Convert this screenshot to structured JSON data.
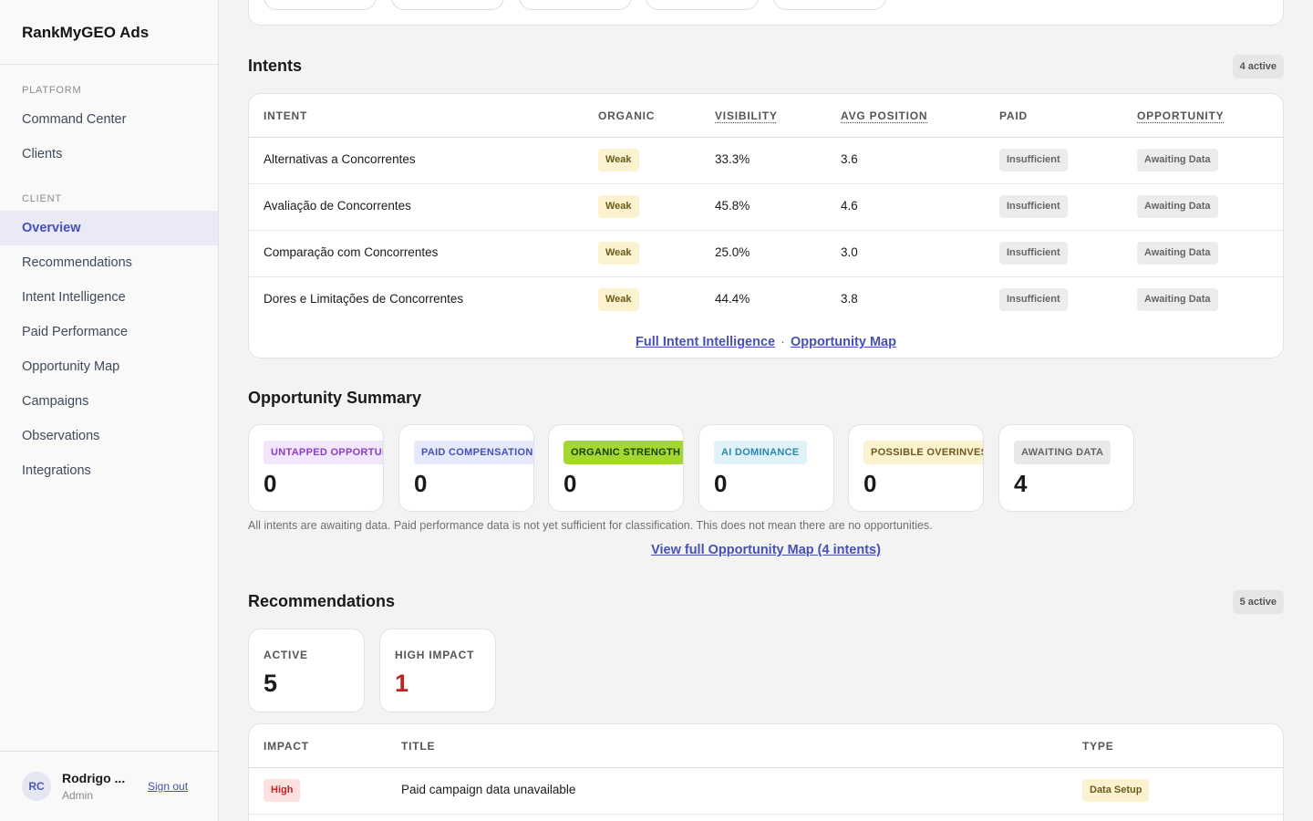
{
  "app": {
    "brand": "RankMyGEO Ads"
  },
  "sidebar": {
    "platform_label": "PLATFORM",
    "platform_items": [
      {
        "label": "Command Center"
      },
      {
        "label": "Clients"
      }
    ],
    "client_label": "CLIENT",
    "client_items": [
      {
        "label": "Overview",
        "active": true
      },
      {
        "label": "Recommendations"
      },
      {
        "label": "Intent Intelligence"
      },
      {
        "label": "Paid Performance"
      },
      {
        "label": "Opportunity Map"
      },
      {
        "label": "Campaigns"
      },
      {
        "label": "Observations"
      },
      {
        "label": "Integrations"
      }
    ],
    "user": {
      "initials": "RC",
      "name": "Rodrigo ...",
      "role": "Admin",
      "signout": "Sign out"
    }
  },
  "intents": {
    "title": "Intents",
    "count_badge": "4 active",
    "headers": [
      "INTENT",
      "ORGANIC",
      "VISIBILITY",
      "AVG POSITION",
      "PAID",
      "OPPORTUNITY"
    ],
    "rows": [
      {
        "intent": "Alternativas a Concorrentes",
        "organic": "Weak",
        "visibility": "33.3%",
        "avg_position": "3.6",
        "paid": "Insufficient",
        "opportunity": "Awaiting Data"
      },
      {
        "intent": "Avaliação de Concorrentes",
        "organic": "Weak",
        "visibility": "45.8%",
        "avg_position": "4.6",
        "paid": "Insufficient",
        "opportunity": "Awaiting Data"
      },
      {
        "intent": "Comparação com Concorrentes",
        "organic": "Weak",
        "visibility": "25.0%",
        "avg_position": "3.0",
        "paid": "Insufficient",
        "opportunity": "Awaiting Data"
      },
      {
        "intent": "Dores e Limitações de Concorrentes",
        "organic": "Weak",
        "visibility": "44.4%",
        "avg_position": "3.8",
        "paid": "Insufficient",
        "opportunity": "Awaiting Data"
      }
    ],
    "link_intel": "Full Intent Intelligence",
    "link_sep": "·",
    "link_map": "Opportunity Map"
  },
  "opportunity_summary": {
    "title": "Opportunity Summary",
    "cards": [
      {
        "label": "UNTAPPED OPPORTUNITY",
        "value": "0",
        "bg": "#f1e6fb",
        "fg": "#8a3fc6"
      },
      {
        "label": "PAID COMPENSATION",
        "value": "0",
        "bg": "#e6e9fb",
        "fg": "#4650b8"
      },
      {
        "label": "ORGANIC STRENGTH",
        "value": "0",
        "bg": "#a3d92f",
        "fg": "#1f3a08"
      },
      {
        "label": "AI DOMINANCE",
        "value": "0",
        "bg": "#e1f1f8",
        "fg": "#2a88b0"
      },
      {
        "label": "POSSIBLE OVERINVESTMENT",
        "value": "0",
        "bg": "#fbf3cf",
        "fg": "#6b5a1a"
      },
      {
        "label": "AWAITING DATA",
        "value": "4",
        "bg": "#e8e8e8",
        "fg": "#666666"
      }
    ],
    "note": "All intents are awaiting data. Paid performance data is not yet sufficient for classification. This does not mean there are no opportunities.",
    "link": "View full Opportunity Map (4 intents)"
  },
  "recommendations": {
    "title": "Recommendations",
    "count_badge": "5 active",
    "stats": [
      {
        "label": "ACTIVE",
        "value": "5"
      },
      {
        "label": "HIGH IMPACT",
        "value": "1"
      }
    ],
    "headers": [
      "IMPACT",
      "TITLE",
      "TYPE"
    ],
    "rows": [
      {
        "impact": "High",
        "title": "Paid campaign data unavailable",
        "type": "Data Setup"
      }
    ]
  }
}
